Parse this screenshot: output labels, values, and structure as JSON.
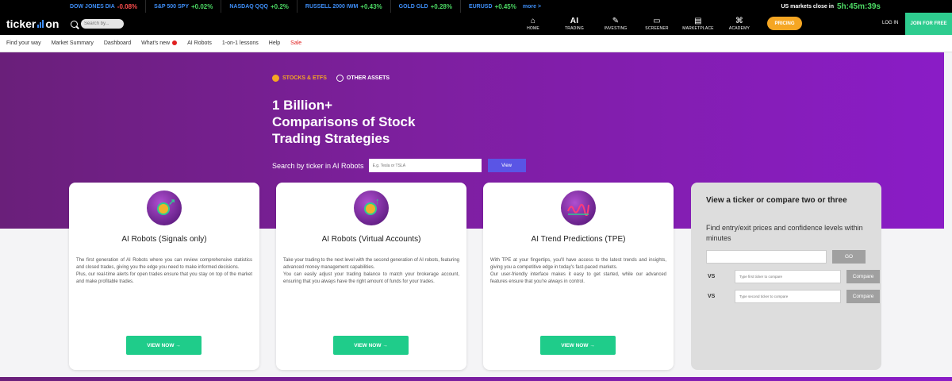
{
  "ticker_strip": {
    "items": [
      {
        "name": "DOW JONES DIA",
        "change": "-0.08%",
        "dir": "neg"
      },
      {
        "name": "S&P 500 SPY",
        "change": "+0.02%",
        "dir": "pos"
      },
      {
        "name": "NASDAQ QQQ",
        "change": "+0.2%",
        "dir": "pos"
      },
      {
        "name": "RUSSELL 2000 IWM",
        "change": "+0.43%",
        "dir": "pos"
      },
      {
        "name": "GOLD GLD",
        "change": "+0.28%",
        "dir": "pos"
      },
      {
        "name": "EURUSD",
        "change": "+0.45%",
        "dir": "pos"
      }
    ],
    "more_label": "more >",
    "market_close_label": "US markets close in",
    "market_close_timer": "5h:45m:39s"
  },
  "header": {
    "logo_left": "ticker",
    "logo_right": "on",
    "search_placeholder": "Search by...",
    "nav": [
      {
        "label": "HOME",
        "icon": "home-icon",
        "glyph": "⌂"
      },
      {
        "label": "TRADING",
        "icon": "ai-icon",
        "glyph": "AI"
      },
      {
        "label": "INVESTING",
        "icon": "wand-icon",
        "glyph": "✎"
      },
      {
        "label": "SCREENER",
        "icon": "monitor-icon",
        "glyph": "▭"
      },
      {
        "label": "MARKETPLACE",
        "icon": "store-icon",
        "glyph": "▤"
      },
      {
        "label": "ACADEMY",
        "icon": "academy-icon",
        "glyph": "⌘"
      }
    ],
    "pricing_label": "PRICING",
    "login_label": "LOG IN",
    "join_label": "JOIN FOR FREE"
  },
  "subnav": {
    "items": [
      "Find your way",
      "Market Summary",
      "Dashboard",
      "What's new",
      "AI Robots",
      "1-on-1 lessons",
      "Help",
      "Sale"
    ]
  },
  "hero": {
    "tab_stocks": "STOCKS & ETFS",
    "tab_other": "OTHER ASSETS",
    "title_line1": "1 Billion+",
    "title_line2": "Comparisons of Stock",
    "title_line3": "Trading Strategies",
    "search_label": "Search by ticker in AI Robots",
    "search_placeholder": "E.g. Tesla or TSLA",
    "view_label": "View"
  },
  "cards": [
    {
      "title": "AI Robots (Signals only)",
      "text": "The first generation of AI Robots where you can review comprehensive statistics and closed trades, giving you the edge you need to make informed decisions.\nPlus, our real-time alerts for open trades ensure that you stay on top of the market and make profitable trades.",
      "button": "VIEW NOW →"
    },
    {
      "title": "AI Robots (Virtual Accounts)",
      "text": "Take your trading to the next level with the second generation of AI robots, featuring advanced money management capabilities.\nYou can easily adjust your trading balance to match your brokerage account, ensuring that you always have the right amount of funds for your trades.",
      "button": "VIEW NOW →"
    },
    {
      "title": "AI Trend Predictions (TPE)",
      "text": "With TPE at your fingertips, you'll have access to the latest trends and insights, giving you a competitive edge in today's fast-paced markets.\nOur user-friendly interface makes it easy to get started, while our advanced features ensure that you're always in control.",
      "button": "VIEW NOW →"
    }
  ],
  "compare": {
    "title": "View a ticker or compare two or three",
    "subtitle": "Find entry/exit prices and confidence levels within minutes",
    "go_label": "GO",
    "vs_label": "VS",
    "second_placeholder": "Type first ticker to compare",
    "third_placeholder": "Type second ticker to compare",
    "compare_label": "Compare"
  },
  "colors": {
    "accent_orange": "#f5a623",
    "accent_green": "#1fcc8a",
    "hero_purple": "#7e1fa0",
    "ticker_blue": "#3e8ef7"
  }
}
